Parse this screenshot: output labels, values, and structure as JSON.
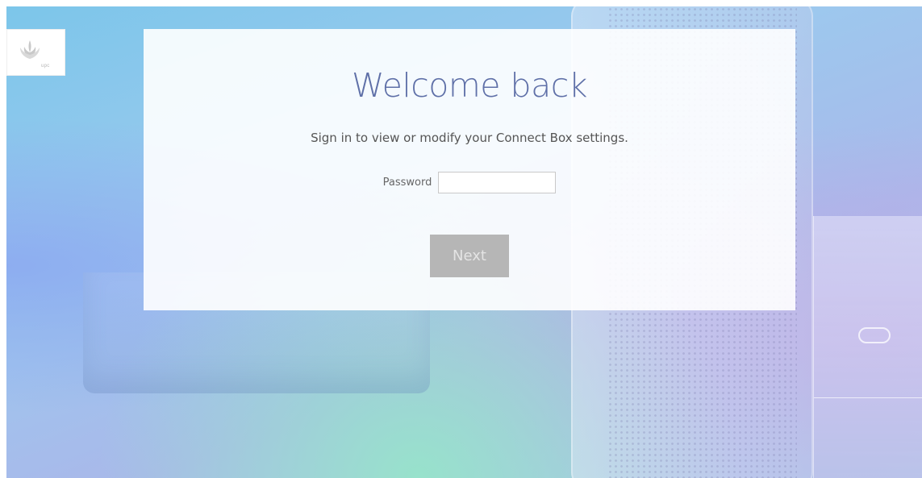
{
  "brand": {
    "logo_text": "upc",
    "logo_icon": "upc-flame-icon"
  },
  "login": {
    "title": "Welcome back",
    "subtitle": "Sign in to view or modify your Connect Box settings.",
    "password_label": "Password",
    "password_value": "",
    "next_label": "Next",
    "next_enabled": false
  },
  "colors": {
    "title": "#5f70a8",
    "button_disabled": "#b6b6b6",
    "panel": "#ffffff"
  }
}
